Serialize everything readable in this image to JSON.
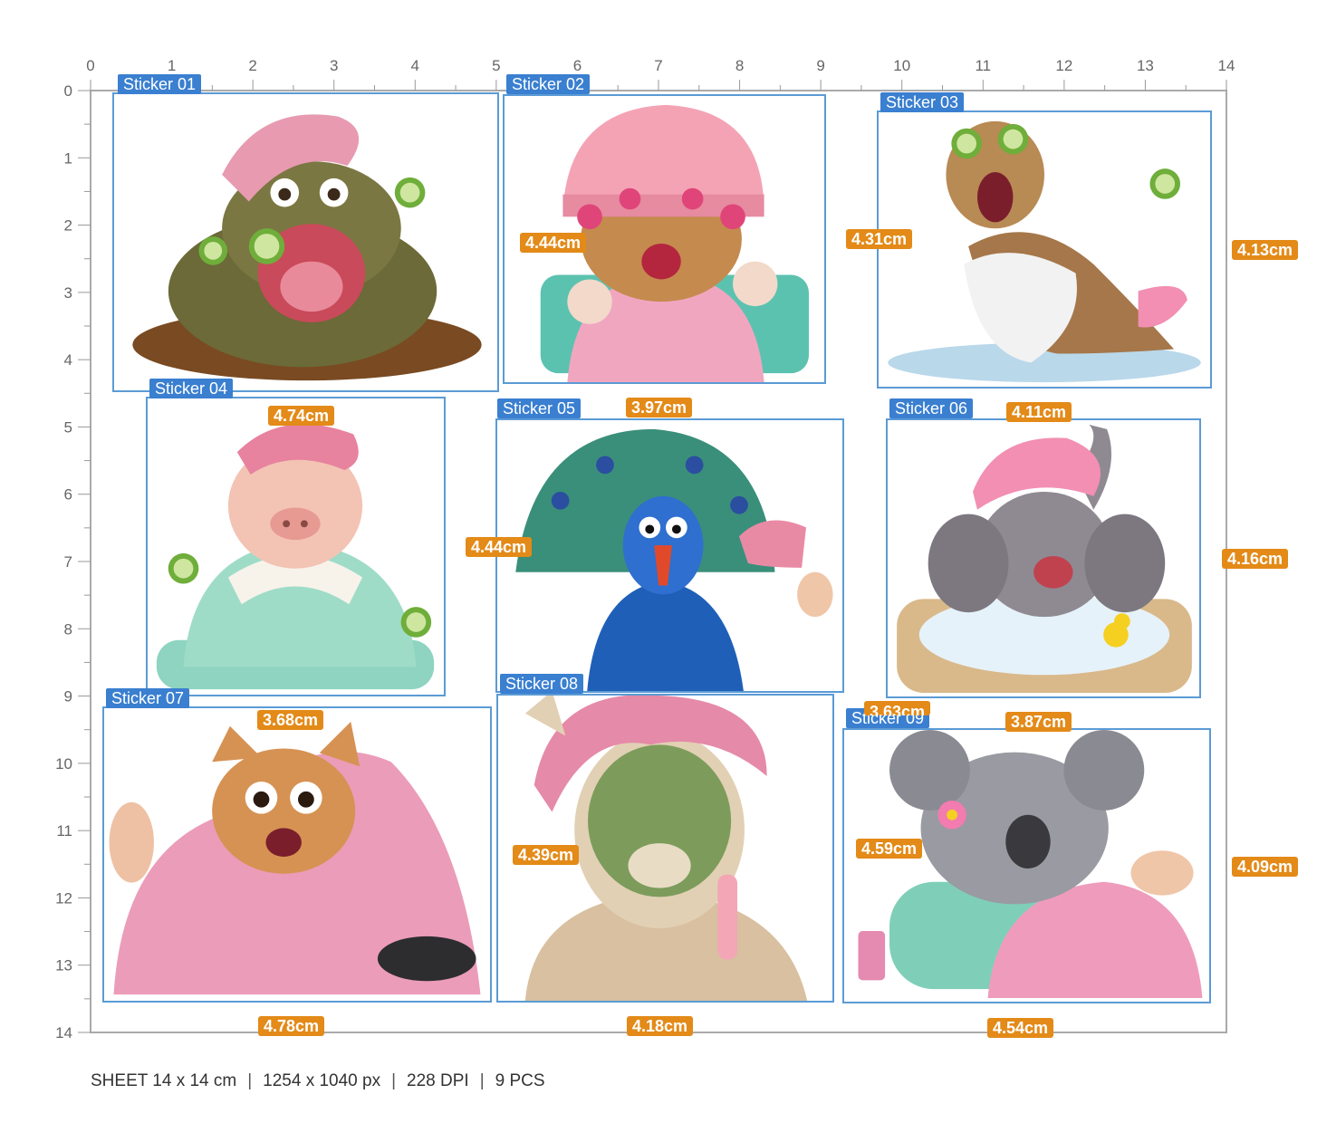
{
  "sheet": {
    "width_cm": 14,
    "height_cm": 14,
    "x_ticks": [
      "0",
      "1",
      "2",
      "3",
      "4",
      "5",
      "6",
      "7",
      "8",
      "9",
      "10",
      "11",
      "12",
      "13",
      "14"
    ],
    "y_ticks": [
      "0",
      "1",
      "2",
      "3",
      "4",
      "5",
      "6",
      "7",
      "8",
      "9",
      "10",
      "11",
      "12",
      "13",
      "14"
    ],
    "colors": {
      "frame": "#5b9bd5",
      "tag": "#3a7fd0",
      "dimension": "#e38a18",
      "ruler": "#999999"
    }
  },
  "stickers": [
    {
      "tag": "Sticker 01",
      "width_label": "4.74cm",
      "height_label": "",
      "subject": "hippo-mud-bath",
      "icon": "hippo-icon"
    },
    {
      "tag": "Sticker 02",
      "width_label": "3.97cm",
      "height_label": "4.44cm",
      "subject": "cat-hair-dryer",
      "icon": "cat-icon"
    },
    {
      "tag": "Sticker 03",
      "width_label": "4.11cm",
      "height_label": "4.31cm",
      "subject": "lemur-cucumber",
      "icon": "lemur-icon"
    },
    {
      "tag": "Sticker 04",
      "width_label": "3.68cm",
      "height_label": "",
      "subject": "pig-bathrobe",
      "icon": "pig-icon"
    },
    {
      "tag": "Sticker 05",
      "width_label": "",
      "height_label": "4.44cm",
      "subject": "peacock-blow-dry",
      "icon": "peacock-icon"
    },
    {
      "tag": "Sticker 06",
      "width_label": "3.87cm",
      "height_label": "4.16cm",
      "subject": "elephant-bubble-bath",
      "icon": "elephant-icon"
    },
    {
      "tag": "Sticker 07",
      "width_label": "4.78cm",
      "height_label": "",
      "subject": "chihuahua-towel",
      "icon": "chihuahua-icon"
    },
    {
      "tag": "Sticker 08",
      "width_label": "4.18cm",
      "height_label": "4.39cm",
      "subject": "llama-face-mask",
      "icon": "llama-icon"
    },
    {
      "tag": "Sticker 09",
      "width_label": "4.54cm",
      "height_label": "4.59cm",
      "subject": "koala-manicure",
      "icon": "koala-icon"
    }
  ],
  "side_labels": {
    "row1": "4.13cm",
    "row3": "4.09cm"
  },
  "partial_label": "3.63cm",
  "footer": {
    "size": "SHEET 14 x 14 cm",
    "pixels": "1254 x 1040 px",
    "dpi": "228 DPI",
    "count": "9 PCS",
    "separator": "|"
  }
}
